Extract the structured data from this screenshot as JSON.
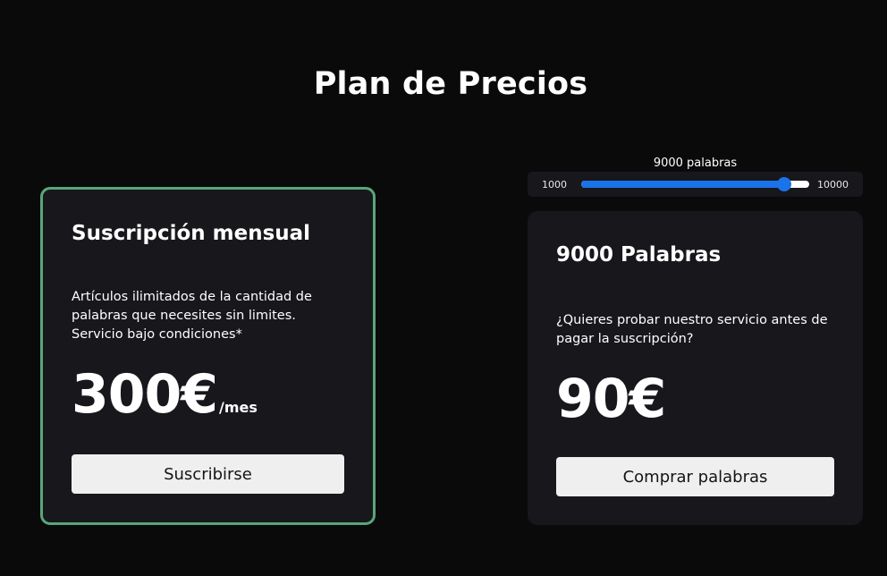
{
  "page": {
    "title": "Plan de Precios"
  },
  "colors": {
    "background": "#0a0a0a",
    "card": "#17171c",
    "highlight_border": "#5aa57c",
    "slider_accent": "#1a73e8",
    "button_bg": "#efefef"
  },
  "subscription": {
    "title": "Suscripción mensual",
    "description": "Artículos ilimitados de la cantidad de palabras que necesites sin limites. Servicio bajo condiciones*",
    "price": "300€",
    "price_unit": "/mes",
    "button_label": "Suscribirse"
  },
  "slider": {
    "label": "9000 palabras",
    "min_label": "1000",
    "max_label": "10000",
    "min": 1000,
    "max": 10000,
    "value": 9000
  },
  "words_plan": {
    "title": "9000 Palabras",
    "description": "¿Quieres probar nuestro servicio antes de pagar la suscripción?",
    "price": "90€",
    "button_label": "Comprar palabras"
  }
}
